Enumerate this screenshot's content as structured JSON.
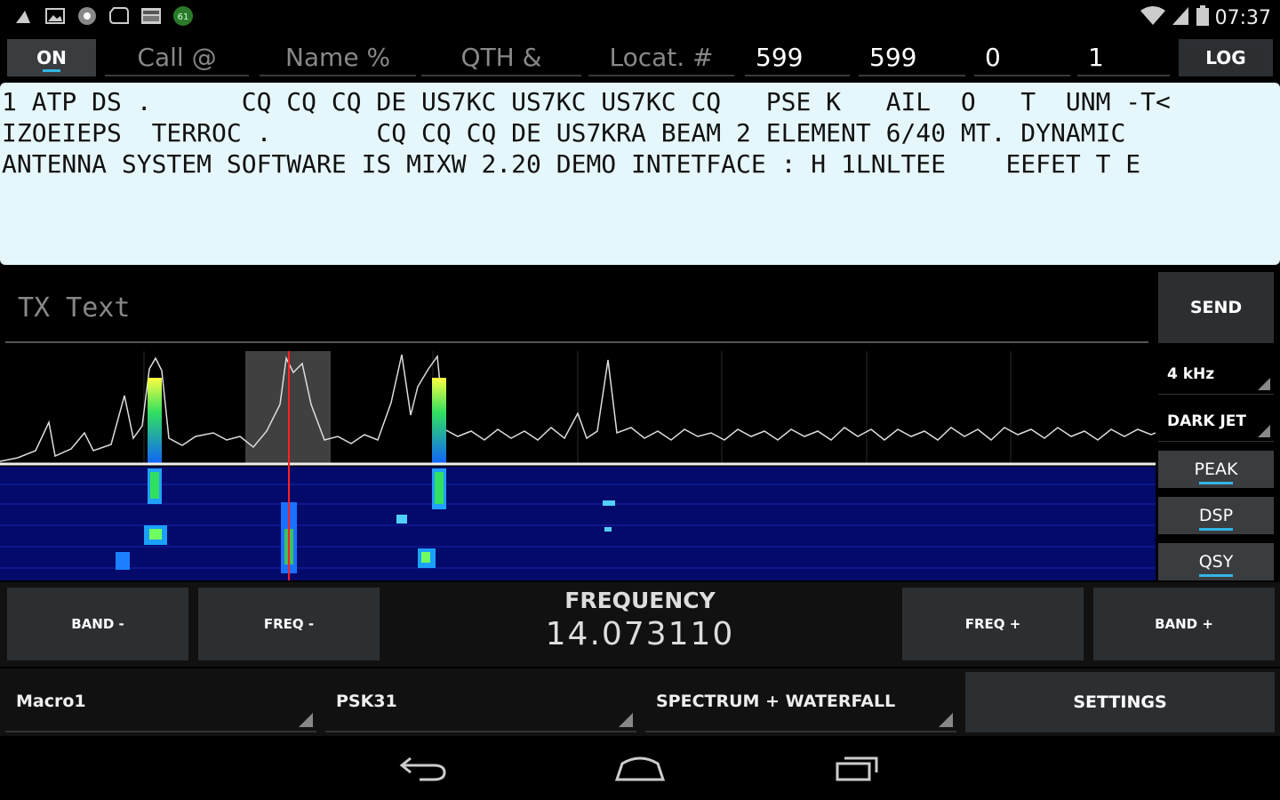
{
  "status_bar": {
    "time": "07:37",
    "left_icons": [
      "usb-icon",
      "image-icon",
      "settings-dot-icon",
      "shape-icon",
      "keyboard-icon",
      "notification-icon"
    ],
    "right_icons": [
      "wifi-icon",
      "signal-icon",
      "battery-icon"
    ]
  },
  "top_fields": {
    "on_label": "ON",
    "call_placeholder": "Call @",
    "name_placeholder": "Name %",
    "qth_placeholder": "QTH &",
    "locator_placeholder": "Locat. #",
    "rst_sent": "599",
    "rst_rcvd": "599",
    "counter_1": "0",
    "counter_2": "1",
    "log_label": "LOG"
  },
  "rx_text": {
    "line1": "1 ATP DS .      CQ CQ CQ DE US7KC US7KC US7KC CQ   PSE K   AIL  O   T  UNM -T<",
    "line2": "IZOEIEPS  TERROC .       CQ CQ CQ DE US7KRA BEAM 2 ELEMENT 6/40 MT. DYNAMIC",
    "line3": "ANTENNA SYSTEM SOFTWARE IS MIXW 2.20 DEMO INTETFACE : H 1LNLTEE    EEFET T E"
  },
  "tx": {
    "placeholder": "TX Text",
    "send_label": "SEND"
  },
  "side_controls": {
    "bandwidth": "4 kHz",
    "palette": "DARK JET",
    "peak_label": "PEAK",
    "dsp_label": "DSP",
    "qsy_label": "QSY"
  },
  "frequency": {
    "label": "FREQUENCY",
    "value": "14.073110",
    "band_down": "BAND -",
    "freq_down": "FREQ -",
    "freq_up": "FREQ +",
    "band_up": "BAND +"
  },
  "bottom": {
    "macro": "Macro1",
    "mode": "PSK31",
    "view": "SPECTRUM + WATERFALL",
    "settings_label": "SETTINGS"
  },
  "colors": {
    "accent": "#33b5e5",
    "rx_background": "#e6f7fb",
    "button_background": "#2c2f32",
    "waterfall_background": "#030a6a",
    "marker": "#ff2020"
  },
  "nav_icons": [
    "back-icon",
    "home-icon",
    "recents-icon"
  ]
}
